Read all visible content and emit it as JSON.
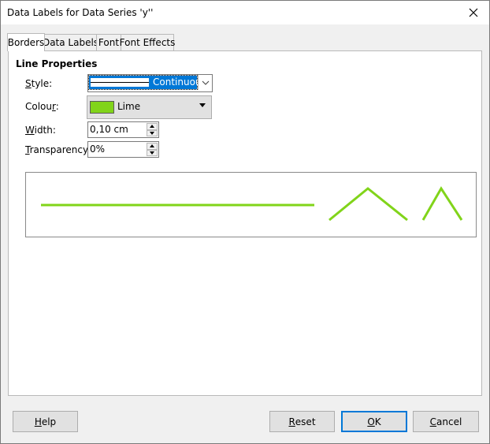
{
  "window": {
    "title": "Data Labels for Data Series 'y''"
  },
  "tabs": [
    {
      "label": "Borders",
      "active": true
    },
    {
      "label": "Data Labels",
      "active": false
    },
    {
      "label": "Font",
      "active": false
    },
    {
      "label": "Font Effects",
      "active": false
    }
  ],
  "line_properties": {
    "section_title": "Line Properties",
    "style": {
      "label_pre": "",
      "label_ul": "S",
      "label_post": "tyle:",
      "value": "Continuous"
    },
    "colour": {
      "label_pre": "Colou",
      "label_ul": "r",
      "label_post": ":",
      "value": "Lime",
      "swatch_color": "#81d41a"
    },
    "width": {
      "label_pre": "",
      "label_ul": "W",
      "label_post": "idth:",
      "value": "0,10 cm"
    },
    "transparency": {
      "label_pre": "",
      "label_ul": "T",
      "label_post": "ransparency:",
      "value": "0%"
    }
  },
  "preview": {
    "line_color": "#81d41a"
  },
  "buttons": {
    "help": {
      "pre": "",
      "ul": "H",
      "post": "elp"
    },
    "reset": {
      "pre": "",
      "ul": "R",
      "post": "eset"
    },
    "ok": {
      "pre": "",
      "ul": "O",
      "post": "K"
    },
    "cancel": {
      "pre": "",
      "ul": "C",
      "post": "ancel"
    }
  },
  "icons": {
    "close": "close-icon",
    "dropdown": "chevron-down-icon",
    "spin_up": "spin-up-icon",
    "spin_down": "spin-down-icon"
  }
}
